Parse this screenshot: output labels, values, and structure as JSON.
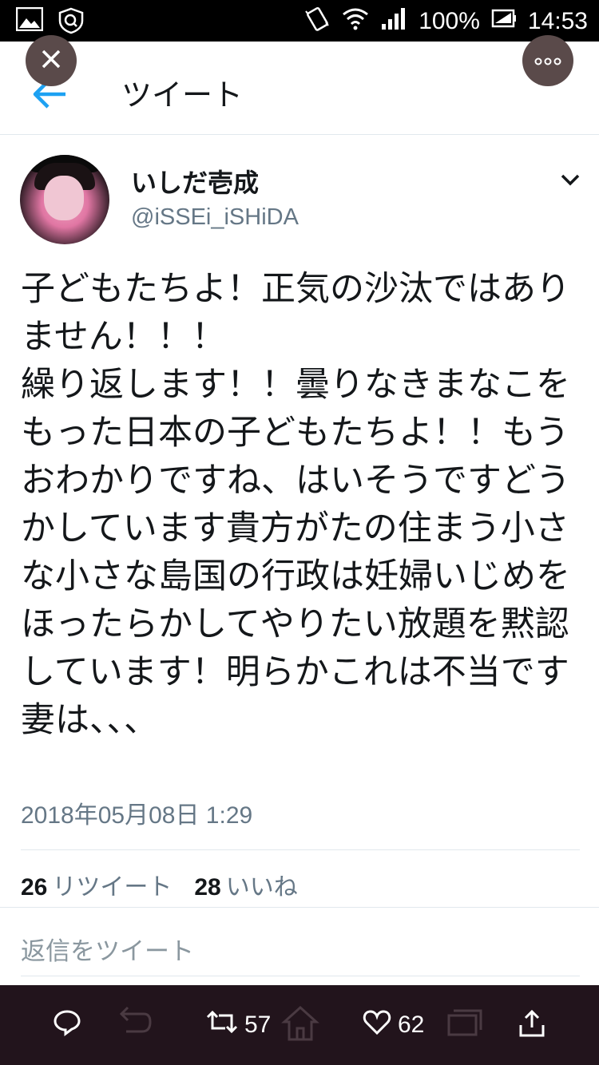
{
  "status_bar": {
    "battery_percent": "100%",
    "time": "14:53",
    "icons": [
      "image-icon",
      "shield-icon",
      "vibrate-icon",
      "wifi-icon",
      "signal-icon",
      "battery-icon"
    ]
  },
  "header": {
    "title": "ツイート",
    "icons": [
      "back-arrow-icon",
      "close-icon",
      "more-icon"
    ]
  },
  "tweet": {
    "display_name": "いしだ壱成",
    "handle": "@iSSEi_iSHiDA",
    "text": "子どもたちよ！正気の沙汰ではありません！！！\n繰り返します！！曇りなきまなこをもった日本の子どもたちよ！！もうおわかりですね、はいそうですどうかしています貴方がたの住まう小さな小さな島国の行政は妊婦いじめをほったらかしてやりたい放題を黙認しています！明らかこれは不当です妻は、、、",
    "timestamp": "2018年05月08日 1:29"
  },
  "stats": {
    "retweets_count": "26",
    "retweets_label": "リツイート",
    "likes_count": "28",
    "likes_label": "いいね"
  },
  "reply": {
    "placeholder": "返信をツイート"
  },
  "bottom_bar": {
    "retweet_count": "57",
    "like_count": "62"
  },
  "colors": {
    "accent": "#1da1f2",
    "text_secondary": "#657786",
    "bottom_bar": "#22141c"
  }
}
